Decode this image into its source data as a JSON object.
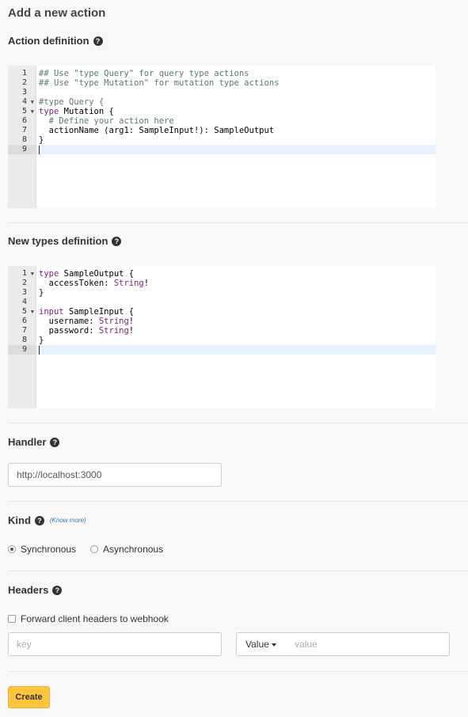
{
  "page": {
    "title": "Add a new action"
  },
  "action_definition": {
    "heading": "Action definition",
    "lines": [
      {
        "num": "1",
        "fold": false,
        "segments": [
          {
            "t": "## Use \"type Query\" for query type actions",
            "c": "comment"
          }
        ]
      },
      {
        "num": "2",
        "fold": false,
        "segments": [
          {
            "t": "## Use \"type Mutation\" for mutation type actions",
            "c": "comment"
          }
        ]
      },
      {
        "num": "3",
        "fold": false,
        "segments": []
      },
      {
        "num": "4",
        "fold": true,
        "segments": [
          {
            "t": "#type Query {",
            "c": "comment"
          }
        ]
      },
      {
        "num": "5",
        "fold": true,
        "segments": [
          {
            "t": "type",
            "c": "kw"
          },
          {
            "t": " Mutation {",
            "c": ""
          }
        ]
      },
      {
        "num": "6",
        "fold": false,
        "segments": [
          {
            "t": "  # Define your action here",
            "c": "comment"
          }
        ]
      },
      {
        "num": "7",
        "fold": false,
        "segments": [
          {
            "t": "  actionName (arg1: SampleInput!): SampleOutput",
            "c": ""
          }
        ]
      },
      {
        "num": "8",
        "fold": false,
        "segments": [
          {
            "t": "}",
            "c": ""
          }
        ]
      },
      {
        "num": "9",
        "fold": false,
        "active": true,
        "segments": []
      }
    ]
  },
  "types_definition": {
    "heading": "New types definition",
    "lines": [
      {
        "num": "1",
        "fold": true,
        "segments": [
          {
            "t": "type",
            "c": "kw"
          },
          {
            "t": " SampleOutput {",
            "c": ""
          }
        ]
      },
      {
        "num": "2",
        "fold": false,
        "segments": [
          {
            "t": "  accessToken: ",
            "c": ""
          },
          {
            "t": "String",
            "c": "type"
          },
          {
            "t": "!",
            "c": ""
          }
        ]
      },
      {
        "num": "3",
        "fold": false,
        "segments": [
          {
            "t": "}",
            "c": ""
          }
        ]
      },
      {
        "num": "4",
        "fold": false,
        "segments": []
      },
      {
        "num": "5",
        "fold": true,
        "segments": [
          {
            "t": "input",
            "c": "kw"
          },
          {
            "t": " SampleInput {",
            "c": ""
          }
        ]
      },
      {
        "num": "6",
        "fold": false,
        "segments": [
          {
            "t": "  username: ",
            "c": ""
          },
          {
            "t": "String",
            "c": "type"
          },
          {
            "t": "!",
            "c": ""
          }
        ]
      },
      {
        "num": "7",
        "fold": false,
        "segments": [
          {
            "t": "  password: ",
            "c": ""
          },
          {
            "t": "String",
            "c": "type"
          },
          {
            "t": "!",
            "c": ""
          }
        ]
      },
      {
        "num": "8",
        "fold": false,
        "segments": [
          {
            "t": "}",
            "c": ""
          }
        ]
      },
      {
        "num": "9",
        "fold": false,
        "active": true,
        "segments": []
      }
    ]
  },
  "handler": {
    "heading": "Handler",
    "value": "http://localhost:3000"
  },
  "kind": {
    "heading": "Kind",
    "know_more": "(Know more)",
    "options": [
      {
        "label": "Synchronous",
        "checked": true
      },
      {
        "label": "Asynchronous",
        "checked": false
      }
    ]
  },
  "headers": {
    "heading": "Headers",
    "forward_label": "Forward client headers to webhook",
    "forward_checked": false,
    "key_placeholder": "key",
    "value_type_label": "Value",
    "value_placeholder": "value"
  },
  "actions": {
    "create_label": "Create"
  },
  "icons": {
    "help": "question-circle-icon",
    "fold": "fold-arrow-icon",
    "caret": "caret-down-icon"
  }
}
